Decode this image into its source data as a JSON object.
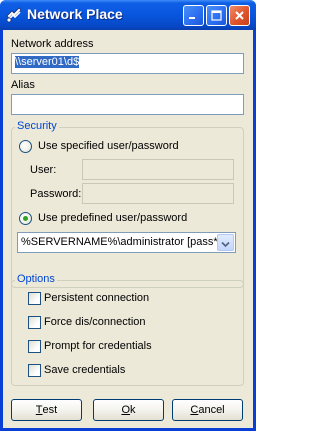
{
  "window": {
    "title": "Network Place"
  },
  "fields": {
    "network_address": {
      "label": "Network address",
      "value": "\\\\server01\\d$"
    },
    "alias": {
      "label": "Alias",
      "value": ""
    }
  },
  "security": {
    "title": "Security",
    "specified": {
      "label": "Use specified user/password",
      "selected": false
    },
    "user_label": "User:",
    "password_label": "Password:",
    "predefined": {
      "label": "Use predefined user/password",
      "selected": true
    },
    "predefined_value": "%SERVERNAME%\\administrator  [pass*****"
  },
  "options": {
    "title": "Options",
    "items": [
      {
        "label": "Persistent connection",
        "checked": false
      },
      {
        "label": "Force dis/connection",
        "checked": false
      },
      {
        "label": "Prompt for credentials",
        "checked": false
      },
      {
        "label": "Save credentials",
        "checked": false
      }
    ]
  },
  "buttons": {
    "test": {
      "accel": "T",
      "rest": "est"
    },
    "ok": {
      "accel": "O",
      "rest": "k"
    },
    "cancel": {
      "accel": "C",
      "rest": "ancel"
    }
  },
  "colors": {
    "titlebar": "#0856dd",
    "dialog_bg": "#ece9d8",
    "group_title": "#0046d5",
    "selection": "#316ac5"
  }
}
